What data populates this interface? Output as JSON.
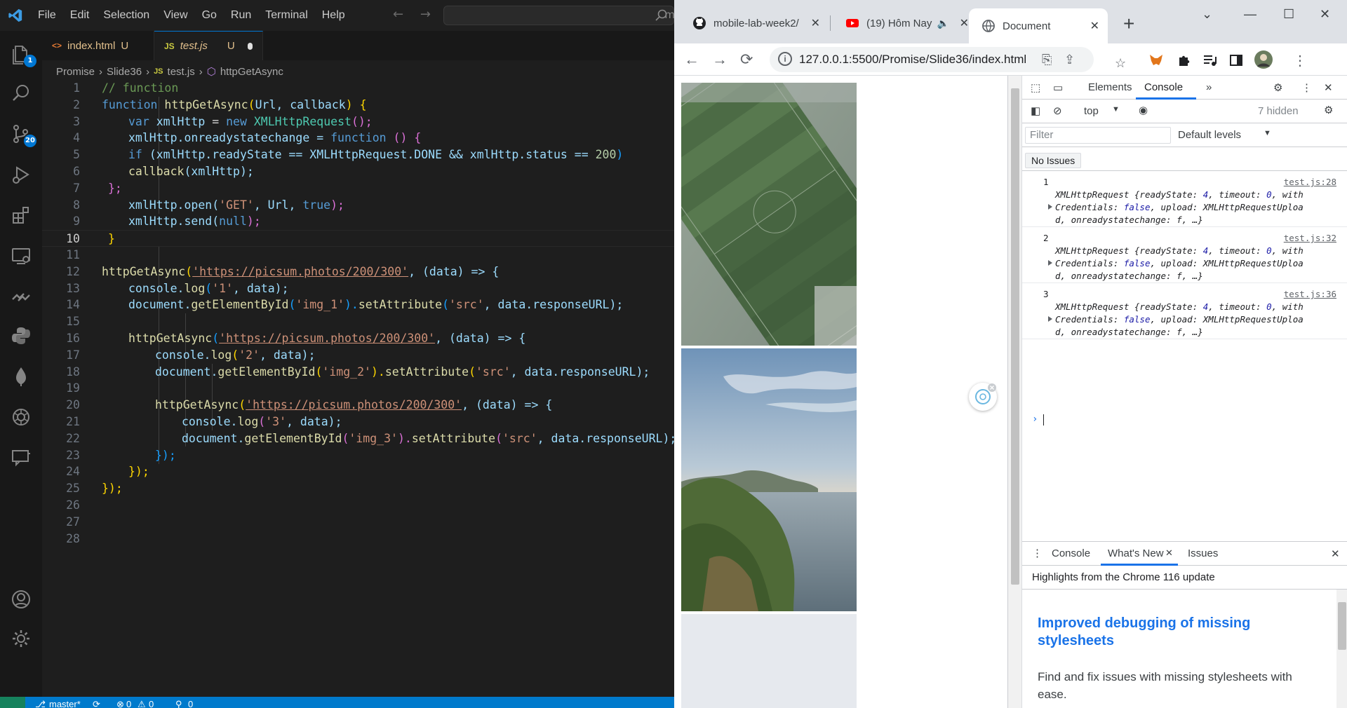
{
  "vscode": {
    "menu": [
      "File",
      "Edit",
      "Selection",
      "View",
      "Go",
      "Run",
      "Terminal",
      "Help"
    ],
    "cmd_partial": "m",
    "badges": {
      "explorer": "1",
      "scm": "20"
    },
    "tabs": [
      {
        "icon": "<>",
        "name": "index.html",
        "status": "U"
      },
      {
        "icon": "JS",
        "name": "test.js",
        "status": "U"
      }
    ],
    "breadcrumb": {
      "folder1": "Promise",
      "folder2": "Slide36",
      "file": "test.js",
      "symbol": "httpGetAsync",
      "js": "JS"
    },
    "line_numbers": [
      "1",
      "2",
      "3",
      "4",
      "5",
      "6",
      "7",
      "8",
      "9",
      "10",
      "11",
      "12",
      "13",
      "14",
      "15",
      "16",
      "17",
      "18",
      "19",
      "20",
      "21",
      "22",
      "23",
      "24",
      "25",
      "26",
      "27",
      "28"
    ],
    "code_tokens": [
      {
        "comment": "// function"
      },
      {
        "kw": "function",
        "fn": "httpGetAsync",
        "p1": "(",
        "a": "Url, callback",
        "p2": ")",
        "p3": "{"
      },
      {
        "kw": "var",
        "v": "xmlHttp",
        "eq": "=",
        "kw2": "new",
        "cls": "XMLHttpRequest",
        "tail": "();"
      },
      {
        "a": "xmlHttp.onreadystatechange =",
        "kw": "function",
        "p": "() {"
      },
      {
        "kw": "if",
        "a": "(xmlHttp.readyState == XMLHttpRequest.DONE && xmlHttp.status ==",
        "num": "200",
        "close": ")"
      },
      {
        "fn": "callback",
        "a": "(xmlHttp);"
      },
      {
        "a": "};"
      },
      {
        "a": "xmlHttp.open(",
        "s": "'GET'",
        "b": ", Url,",
        "kw": "true",
        "c": ");"
      },
      {
        "a": "xmlHttp.send(",
        "kw": "null",
        "c": ");"
      },
      {
        "a": "}"
      },
      {
        "a": ""
      },
      {
        "fn": "httpGetAsync",
        "p": "(",
        "url": "'https://picsum.photos/200/300'",
        "b": ", (data) => {"
      },
      {
        "a": "console.",
        "fn": "log",
        "p": "(",
        "s": "'1'",
        "b": ", data);"
      },
      {
        "a": "document.",
        "fn": "getElementById",
        "p": "(",
        "s": "'img_1'",
        "b": ").",
        "fn2": "setAttribute",
        "p2": "(",
        "s2": "'src'",
        "c": ", data.responseURL);"
      },
      {
        "a": ""
      },
      {
        "fn": "httpGetAsync",
        "p": "(",
        "url": "'https://picsum.photos/200/300'",
        "b": ", (data) => {"
      },
      {
        "a": "console.",
        "fn": "log",
        "p": "(",
        "s": "'2'",
        "b": ", data);"
      },
      {
        "a": "document.",
        "fn": "getElementById",
        "p": "(",
        "s": "'img_2'",
        "b": ").",
        "fn2": "setAttribute",
        "p2": "(",
        "s2": "'src'",
        "c": ", data.responseURL);"
      },
      {
        "a": ""
      },
      {
        "fn": "httpGetAsync",
        "p": "(",
        "url": "'https://picsum.photos/200/300'",
        "b": ", (data) => {"
      },
      {
        "a": "console.",
        "fn": "log",
        "p": "(",
        "s": "'3'",
        "b": ", data);"
      },
      {
        "a": "document.",
        "fn": "getElementById",
        "p": "(",
        "s": "'img_3'",
        "b": ").",
        "fn2": "setAttribute",
        "p2": "(",
        "s2": "'src'",
        "c": ", data.responseURL);"
      },
      {
        "a": "});"
      },
      {
        "a": "});"
      },
      {
        "a": "});"
      },
      {
        "a": ""
      },
      {
        "a": ""
      },
      {
        "a": ""
      }
    ],
    "status": {
      "branch": "master*",
      "errors": "0",
      "warnings": "0",
      "ports": "0"
    }
  },
  "chrome": {
    "tabs": [
      {
        "title": "mobile-lab-week2/"
      },
      {
        "title": "(19) Hôm Nay"
      },
      {
        "title": "Document"
      }
    ],
    "url": "127.0.0.1:5500/Promise/Slide36/index.html",
    "devtools": {
      "tabs": [
        "Elements",
        "Console"
      ],
      "context": "top",
      "hidden": "7 hidden",
      "filter_placeholder": "Filter",
      "levels": "Default levels",
      "no_issues": "No Issues",
      "logs": [
        {
          "index": "1",
          "source": "test.js:28"
        },
        {
          "index": "2",
          "source": "test.js:32"
        },
        {
          "index": "3",
          "source": "test.js:36"
        }
      ],
      "log_parts": {
        "cls": "XMLHttpRequest",
        "k1": "readyState:",
        "v1": "4",
        "k2": "timeout:",
        "v2": "0",
        "k3": "with",
        "k4": "Credentials:",
        "v4": "false",
        "k5": "upload:",
        "v5": "XMLHttpRequestUploa",
        "v5b": "d",
        "k6": "onreadystatechange:",
        "v6": "f",
        "tail": ", …}"
      },
      "drawer": {
        "tabs": [
          "Console",
          "What's New",
          "Issues"
        ],
        "highlights": "Highlights from the Chrome 116 update",
        "title": "Improved debugging of missing stylesheets",
        "desc": "Find and fix issues with missing stylesheets with ease."
      }
    }
  }
}
